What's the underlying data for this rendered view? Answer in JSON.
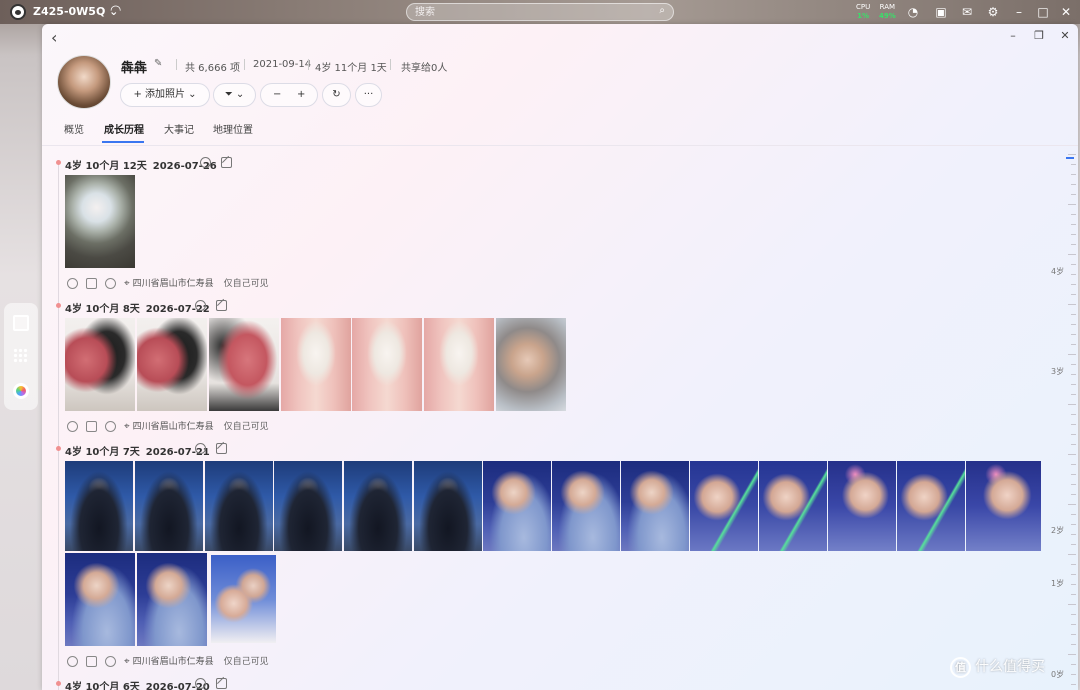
{
  "topbar": {
    "hostname": "Z425-0W5Q",
    "search_placeholder": "搜索",
    "cpu_label": "CPU",
    "cpu_value": "1%",
    "ram_label": "RAM",
    "ram_value": "49%"
  },
  "album": {
    "title": "犇犇",
    "count": "共 6,666 项",
    "birth_date": "2021-09-14",
    "age": "4岁 11个月 1天",
    "shared": "共享给0人"
  },
  "toolbar": {
    "add_photo": "+ 添加照片"
  },
  "tabs": [
    "概览",
    "成长历程",
    "大事记",
    "地理位置"
  ],
  "active_tab": "成长历程",
  "entries": [
    {
      "age": "4岁 10个月 12天",
      "date": "2026-07-26",
      "location": "四川省眉山市仁寿县",
      "visibility": "仅自己可见"
    },
    {
      "age": "4岁 10个月 8天",
      "date": "2026-07-22"
    },
    {
      "age": "4岁 10个月 7天",
      "date": "2026-07-21",
      "location": "四川省眉山市仁寿县",
      "visibility": "仅自己可见"
    },
    {
      "age": "4岁 10个月 6天",
      "date": "2026-07-20"
    }
  ],
  "entry2_footer": {
    "location": "四川省眉山市仁寿县",
    "visibility": "仅自己可见"
  },
  "scale_labels": [
    "4岁",
    "3岁",
    "2岁",
    "1岁",
    "0岁"
  ],
  "watermark": {
    "logo": "值",
    "text": "什么值得买"
  }
}
